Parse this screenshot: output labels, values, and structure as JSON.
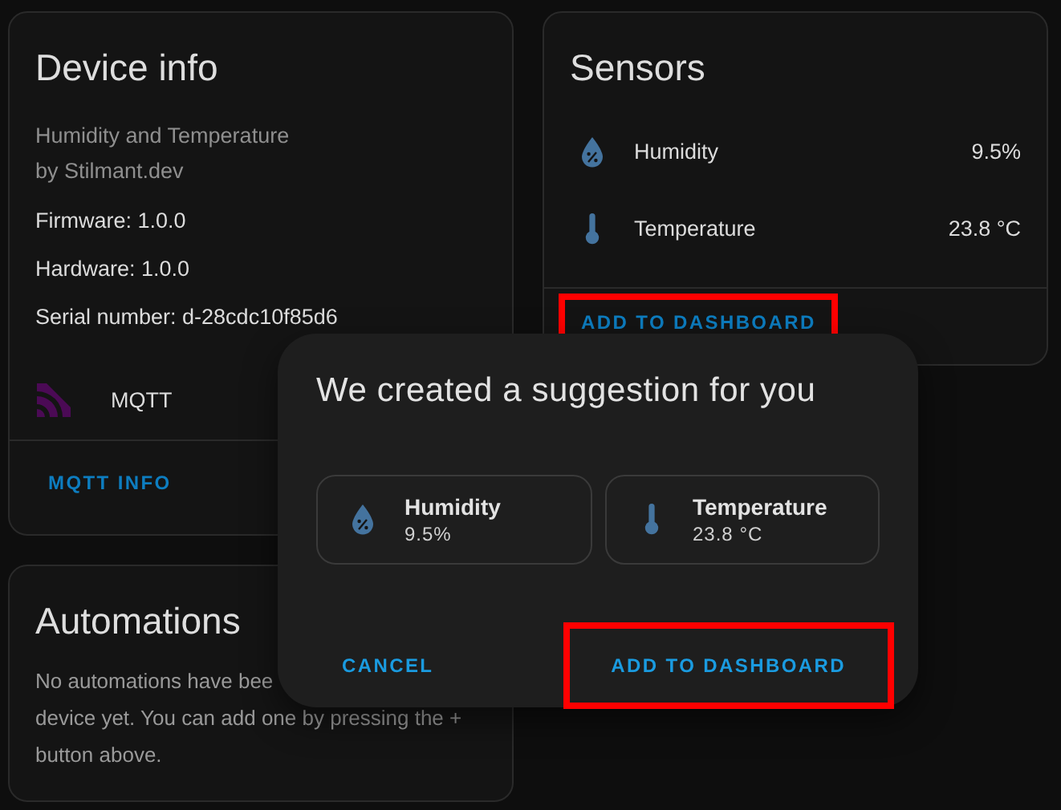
{
  "device_info": {
    "title": "Device info",
    "model": "Humidity and Temperature",
    "manufacturer": "by Stilmant.dev",
    "details": [
      "Firmware: 1.0.0",
      "Hardware: 1.0.0",
      "Serial number: d-28cdc10f85d6"
    ],
    "integration": {
      "name": "MQTT"
    },
    "action": {
      "label": "MQTT INFO"
    }
  },
  "sensors": {
    "title": "Sensors",
    "items": [
      {
        "kind": "humidity",
        "name": "Humidity",
        "value": "9.5%"
      },
      {
        "kind": "temperature",
        "name": "Temperature",
        "value": "23.8 °C"
      }
    ],
    "action": {
      "label": "ADD TO DASHBOARD",
      "highlighted": true
    }
  },
  "automations": {
    "title": "Automations",
    "text_lines": [
      "No automations have bee",
      "device yet. You can add one by pressing the +",
      "button above."
    ]
  },
  "dialog": {
    "title": "We created a suggestion for you",
    "cards": [
      {
        "kind": "humidity",
        "name": "Humidity",
        "value": "9.5%"
      },
      {
        "kind": "temperature",
        "name": "Temperature",
        "value": "23.8 °C"
      }
    ],
    "buttons": [
      {
        "label": "CANCEL",
        "highlighted": false
      },
      {
        "label": "ADD TO DASHBOARD",
        "highlighted": true
      }
    ]
  }
}
